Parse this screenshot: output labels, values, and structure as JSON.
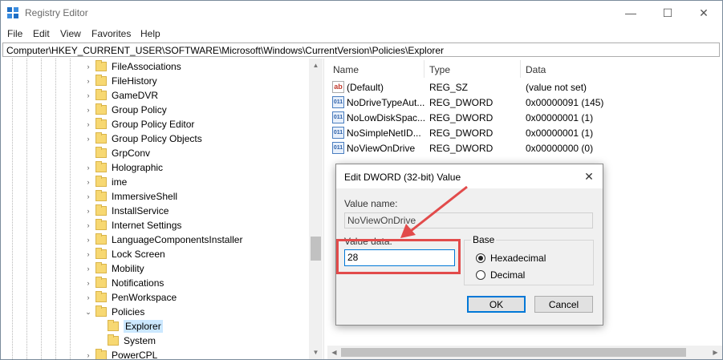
{
  "window": {
    "title": "Registry Editor",
    "minimize_glyph": "—",
    "maximize_glyph": "☐",
    "close_glyph": "✕"
  },
  "menu": [
    "File",
    "Edit",
    "View",
    "Favorites",
    "Help"
  ],
  "address": "Computer\\HKEY_CURRENT_USER\\SOFTWARE\\Microsoft\\Windows\\CurrentVersion\\Policies\\Explorer",
  "tree": {
    "items": [
      {
        "label": "FileAssociations",
        "expandable": true
      },
      {
        "label": "FileHistory",
        "expandable": true
      },
      {
        "label": "GameDVR",
        "expandable": true
      },
      {
        "label": "Group Policy",
        "expandable": true
      },
      {
        "label": "Group Policy Editor",
        "expandable": true
      },
      {
        "label": "Group Policy Objects",
        "expandable": true
      },
      {
        "label": "GrpConv",
        "expandable": false
      },
      {
        "label": "Holographic",
        "expandable": true
      },
      {
        "label": "ime",
        "expandable": true
      },
      {
        "label": "ImmersiveShell",
        "expandable": true
      },
      {
        "label": "InstallService",
        "expandable": true
      },
      {
        "label": "Internet Settings",
        "expandable": true
      },
      {
        "label": "LanguageComponentsInstaller",
        "expandable": true
      },
      {
        "label": "Lock Screen",
        "expandable": true
      },
      {
        "label": "Mobility",
        "expandable": true
      },
      {
        "label": "Notifications",
        "expandable": true
      },
      {
        "label": "PenWorkspace",
        "expandable": true
      },
      {
        "label": "Policies",
        "expandable": true,
        "expanded": true
      },
      {
        "label": "Explorer",
        "child": true,
        "selected": true
      },
      {
        "label": "System",
        "child": true
      },
      {
        "label": "PowerCPL",
        "expandable": true
      }
    ],
    "chevron_right": "›",
    "chevron_down": "⌄"
  },
  "list": {
    "columns": [
      "Name",
      "Type",
      "Data"
    ],
    "rows": [
      {
        "name": "(Default)",
        "type": "REG_SZ",
        "data": "(value not set)",
        "icon": "string-value-icon"
      },
      {
        "name": "NoDriveTypeAut...",
        "type": "REG_DWORD",
        "data": "0x00000091 (145)",
        "icon": "dword-value-icon"
      },
      {
        "name": "NoLowDiskSpac...",
        "type": "REG_DWORD",
        "data": "0x00000001 (1)",
        "icon": "dword-value-icon"
      },
      {
        "name": "NoSimpleNetID...",
        "type": "REG_DWORD",
        "data": "0x00000001 (1)",
        "icon": "dword-value-icon"
      },
      {
        "name": "NoViewOnDrive",
        "type": "REG_DWORD",
        "data": "0x00000000 (0)",
        "icon": "dword-value-icon"
      }
    ]
  },
  "dialog": {
    "title": "Edit DWORD (32-bit) Value",
    "value_name_label": "Value name:",
    "value_name": "NoViewOnDrive",
    "value_data_label": "Value data:",
    "value_data": "28",
    "base_label": "Base",
    "hex_label": "Hexadecimal",
    "dec_label": "Decimal",
    "base_selected": "Hexadecimal",
    "ok_label": "OK",
    "cancel_label": "Cancel",
    "close_glyph": "✕"
  },
  "icons": {
    "string_value": "ab",
    "dword_value": "011"
  },
  "colors": {
    "annotation": "#e24b4b",
    "focus": "#0078d7",
    "selection": "#cce8ff"
  }
}
